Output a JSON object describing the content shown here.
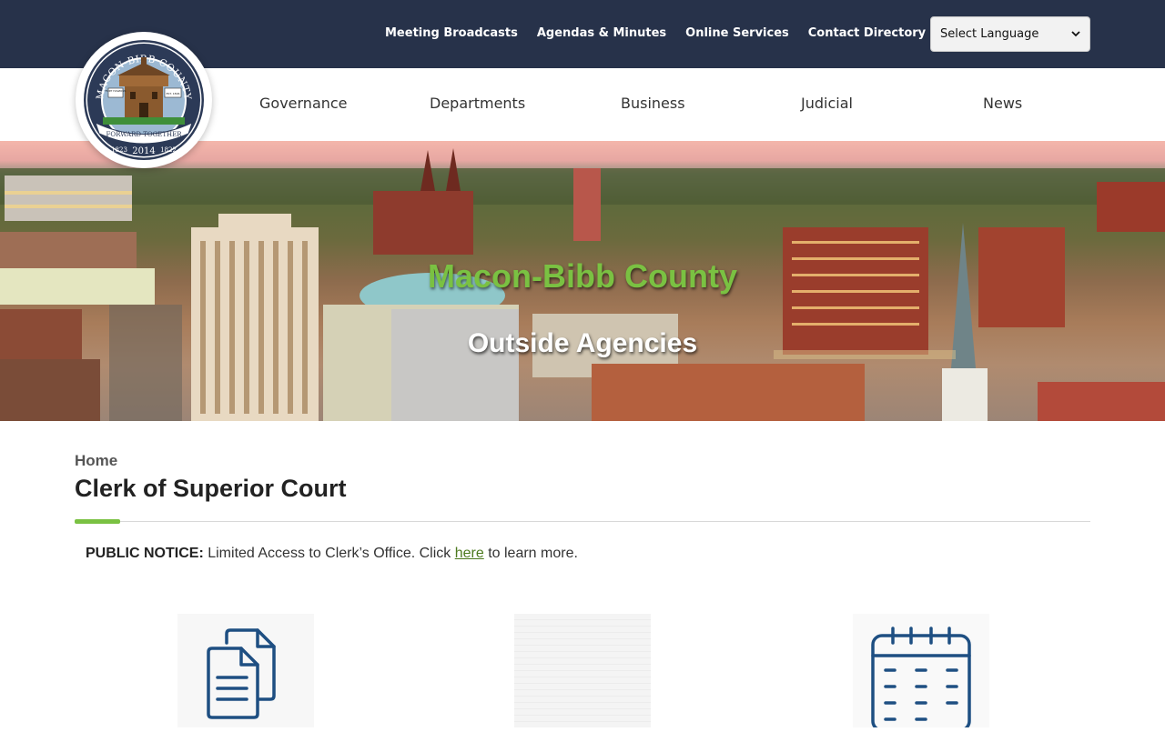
{
  "topnav": {
    "links": [
      "Meeting Broadcasts",
      "Agendas & Minutes",
      "Online Services",
      "Contact Directory"
    ],
    "language_select": "Select Language"
  },
  "logo": {
    "ring_text_top": "MACON-BIBB COUNTY",
    "ring_text_bottom": "FORWARD TOGETHER",
    "year_left": "1823",
    "year_center": "2014",
    "year_right": "1822",
    "sign_left": "FORT HAWKINS",
    "sign_right": "EST. 1806"
  },
  "mainnav": {
    "items": [
      "Governance",
      "Departments",
      "Business",
      "Judicial",
      "News"
    ]
  },
  "hero": {
    "title": "Macon-Bibb County",
    "subtitle": "Outside Agencies"
  },
  "breadcrumb": {
    "home": "Home"
  },
  "page": {
    "title": "Clerk of Superior Court"
  },
  "notice": {
    "label": "PUBLIC NOTICE:",
    "text_before": " Limited Access to Clerk’s Office. Click ",
    "link": "here",
    "text_after": " to learn more."
  },
  "icons": [
    "documents-icon",
    "placeholder-image",
    "calendar-icon"
  ],
  "colors": {
    "topbar": "#27324a",
    "accent_green": "#7ac142",
    "icon_blue": "#1e4f82"
  }
}
